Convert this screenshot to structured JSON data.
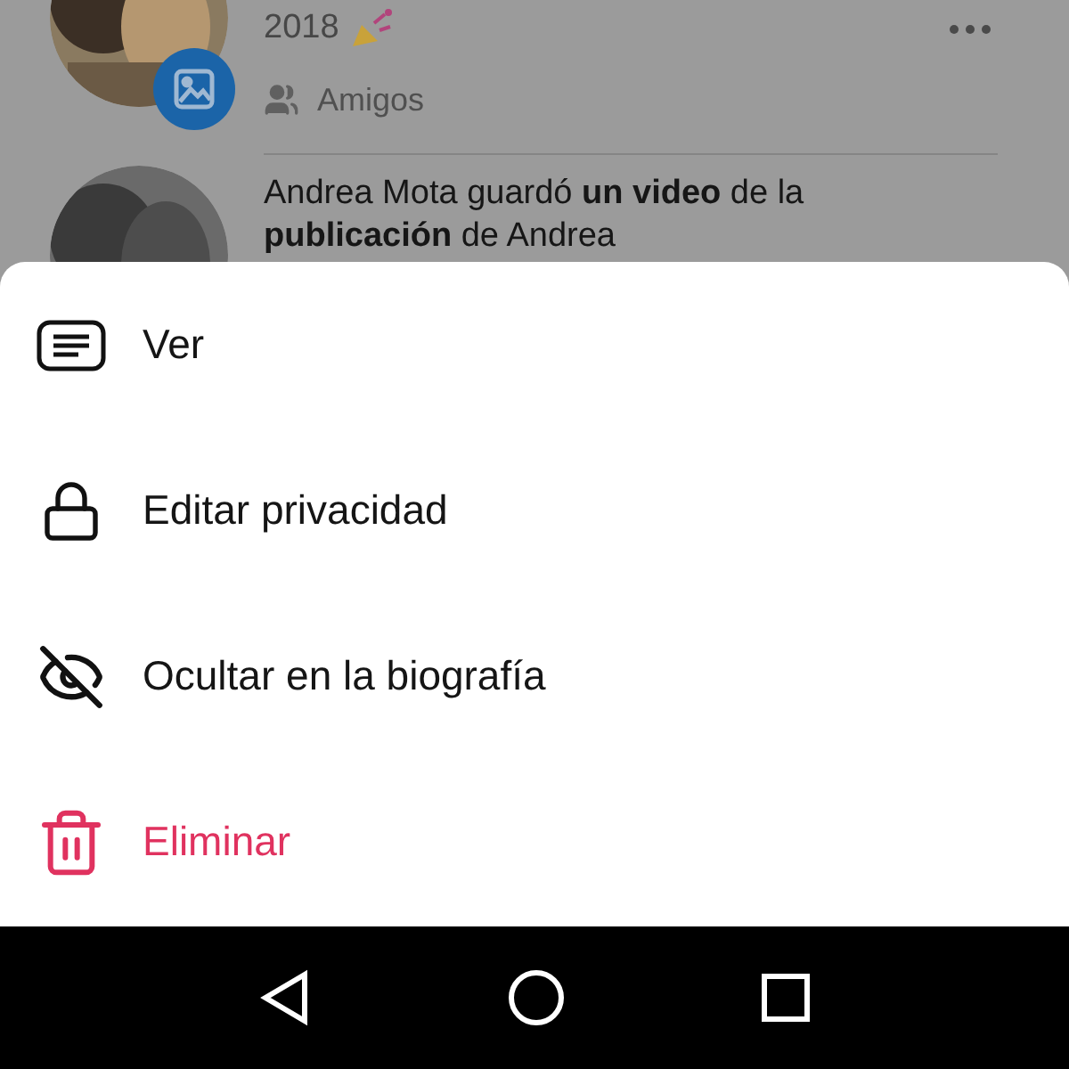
{
  "feed": {
    "post_year": "2018",
    "audience": "Amigos",
    "activity": "Andrea Mota guardó **un video** de la **publicación** de Andrea"
  },
  "menu": [
    {
      "label": "Ver",
      "kind": "view"
    },
    {
      "label": "Editar privacidad",
      "kind": "privacy"
    },
    {
      "label": "Ocultar en la biografía",
      "kind": "hide"
    },
    {
      "label": "Eliminar",
      "kind": "delete"
    }
  ]
}
